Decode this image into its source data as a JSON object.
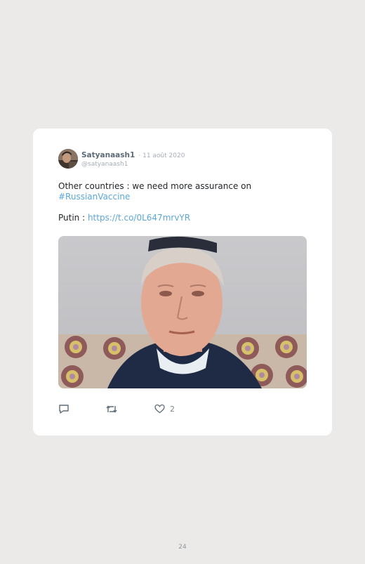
{
  "tweet": {
    "display_name": "Satyanaash1",
    "date": "· 11 août 2020",
    "handle": "@satyanaash1",
    "text_line1": "Other countries : we need more assurance on",
    "hashtag": "#RussianVaccine",
    "putin_prefix": "Putin : ",
    "link": "https://t.co/0L647mrvYR",
    "like_count": "2"
  },
  "icons": {
    "reply": "reply-icon",
    "retweet": "retweet-icon",
    "like": "heart-icon"
  },
  "colors": {
    "page_background": "#ebeae8",
    "card_background": "#ffffff",
    "link": "#5aa7d8",
    "meta_text": "#a6aeb6"
  },
  "page_number": "24"
}
